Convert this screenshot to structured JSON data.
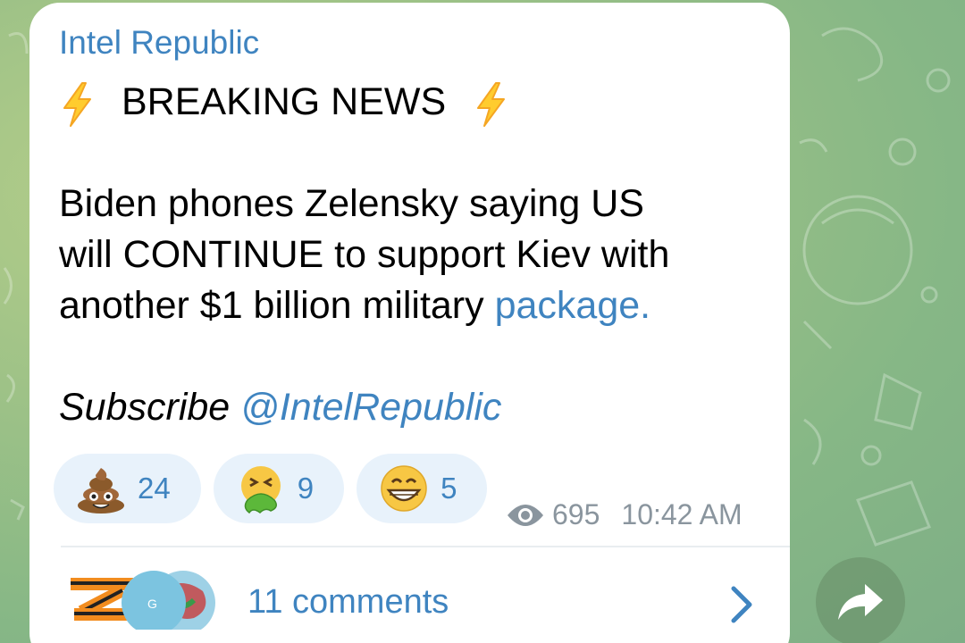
{
  "channel": {
    "name": "Intel Republic"
  },
  "post": {
    "headline": "BREAKING NEWS",
    "body_line1": "Biden phones Zelensky saying US",
    "body_line2": "will CONTINUE to support Kiev with",
    "body_line3_prefix": "another $1 billion military ",
    "body_line3_link": "package.",
    "subscribe_text": "Subscribe ",
    "subscribe_handle": "@IntelRepublic"
  },
  "reactions": [
    {
      "icon": "poop-emoji",
      "count": "24"
    },
    {
      "icon": "vomiting-face-emoji",
      "count": "9"
    },
    {
      "icon": "grinning-face-emoji",
      "count": "5"
    }
  ],
  "meta": {
    "views": "695",
    "time": "10:42 AM"
  },
  "comments": {
    "label": "11 comments",
    "avatar_letter": "G"
  },
  "colors": {
    "accent": "#3f84c0",
    "bubble": "#ffffff",
    "reaction_bg": "#e8f2fb",
    "meta_text": "#8a959e",
    "background": "#9ec287"
  }
}
